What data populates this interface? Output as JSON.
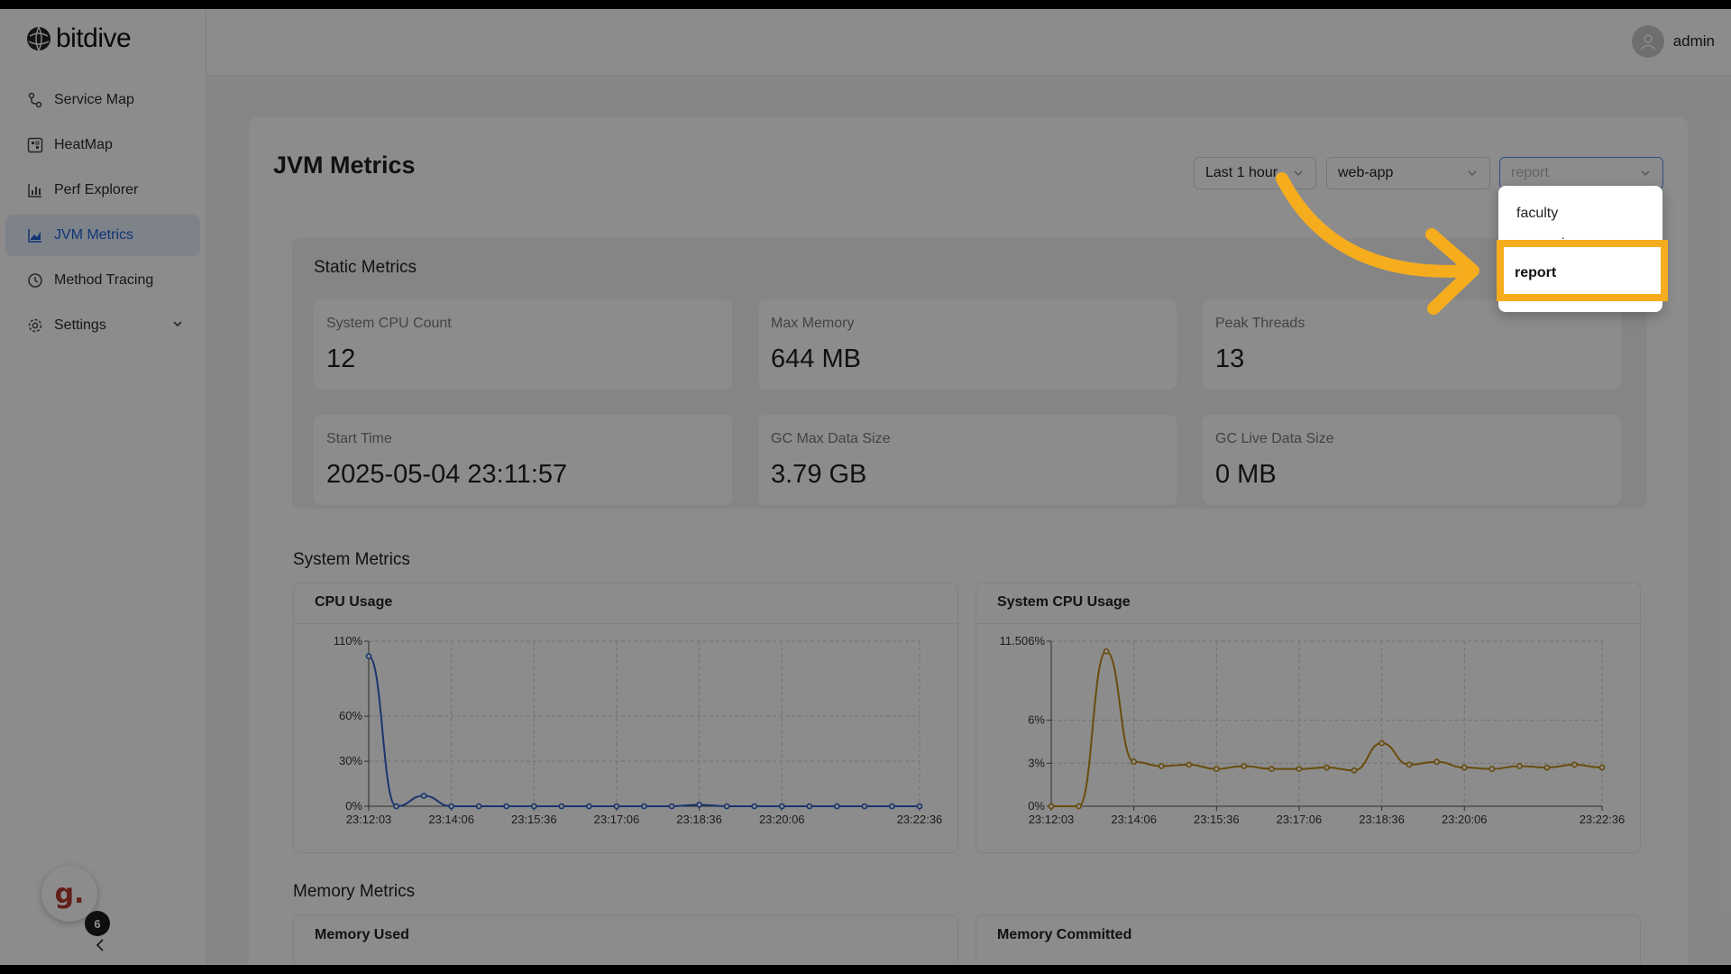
{
  "app": {
    "logo_text": "bitdive"
  },
  "sidebar": {
    "items": [
      {
        "label": "Service Map",
        "icon": "service-map-icon"
      },
      {
        "label": "HeatMap",
        "icon": "heatmap-icon"
      },
      {
        "label": "Perf Explorer",
        "icon": "bar-chart-icon"
      },
      {
        "label": "JVM Metrics",
        "icon": "line-chart-icon",
        "active": true
      },
      {
        "label": "Method Tracing",
        "icon": "clock-icon"
      },
      {
        "label": "Settings",
        "icon": "gear-icon",
        "expandable": true
      }
    ],
    "badge_letter": "g.",
    "badge_count": "6"
  },
  "header": {
    "user": "admin"
  },
  "page": {
    "title": "JVM Metrics",
    "filters": {
      "time_range": "Last 1 hour",
      "service": "web-app",
      "module_placeholder": "report"
    },
    "dropdown_options": [
      "faculty",
      "open-ai",
      "report"
    ],
    "highlighted_option": "report"
  },
  "static_metrics": {
    "title": "Static Metrics",
    "items": [
      {
        "label": "System CPU Count",
        "value": "12"
      },
      {
        "label": "Max Memory",
        "value": "644 MB"
      },
      {
        "label": "Peak Threads",
        "value": "13"
      },
      {
        "label": "Start Time",
        "value": "2025-05-04 23:11:57"
      },
      {
        "label": "GC Max Data Size",
        "value": "3.79 GB"
      },
      {
        "label": "GC Live Data Size",
        "value": "0 MB"
      }
    ]
  },
  "system_metrics": {
    "title": "System Metrics"
  },
  "memory_metrics": {
    "title": "Memory Metrics",
    "charts": [
      "Memory Used",
      "Memory Committed"
    ]
  },
  "colors": {
    "accent": "#1f5fd6",
    "cpu_line": "#2f62c8",
    "sys_cpu_line": "#c08a14",
    "annotation": "#f6ad1d"
  },
  "chart_data": [
    {
      "type": "line",
      "title": "CPU Usage",
      "y_ticks": [
        "0%",
        "30%",
        "60%",
        "110%"
      ],
      "y_tick_values": [
        0,
        30,
        60,
        110
      ],
      "ylim": [
        0,
        110
      ],
      "x_ticks": [
        "23:12:03",
        "23:14:06",
        "23:15:36",
        "23:17:06",
        "23:18:36",
        "23:20:06",
        "23:22:36"
      ],
      "x_tick_index": [
        0,
        3,
        6,
        9,
        12,
        15,
        20
      ],
      "series": [
        {
          "values": [
            100,
            0,
            7,
            0,
            0,
            0,
            0,
            0,
            0,
            0,
            0,
            0,
            1,
            0,
            0,
            0,
            0,
            0,
            0,
            0,
            0
          ]
        }
      ],
      "grid": true
    },
    {
      "type": "line",
      "title": "System CPU Usage",
      "y_ticks": [
        "0%",
        "3%",
        "6%",
        "11.506%"
      ],
      "y_tick_values": [
        0,
        3,
        6,
        11.506
      ],
      "ylim": [
        0,
        11.506
      ],
      "x_ticks": [
        "23:12:03",
        "23:14:06",
        "23:15:36",
        "23:17:06",
        "23:18:36",
        "23:20:06",
        "23:22:36"
      ],
      "x_tick_index": [
        0,
        3,
        6,
        9,
        12,
        15,
        20
      ],
      "series": [
        {
          "values": [
            0,
            0,
            10.8,
            3.1,
            2.8,
            2.9,
            2.6,
            2.8,
            2.6,
            2.6,
            2.7,
            2.5,
            4.4,
            2.9,
            3.1,
            2.7,
            2.6,
            2.8,
            2.7,
            2.9,
            2.7
          ]
        }
      ],
      "grid": true
    }
  ]
}
